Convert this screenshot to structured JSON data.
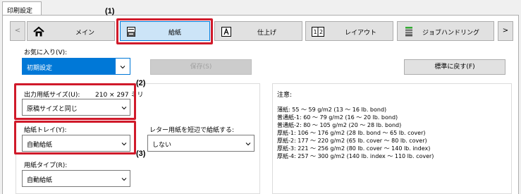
{
  "window": {
    "tab_label": "印刷設定"
  },
  "callouts": {
    "one": "(1)",
    "two": "(2)",
    "three": "(3)"
  },
  "nav": {
    "prev_arrow": "<",
    "next_arrow": ">",
    "tabs": [
      {
        "label": "メイン",
        "icon": "home-icon"
      },
      {
        "label": "給紙",
        "icon": "paper-tray-icon",
        "active": true
      },
      {
        "label": "仕上げ",
        "icon": "finishing-letter-a-icon"
      },
      {
        "label": "レイアウト",
        "icon": "layout-1-2-icon"
      },
      {
        "label": "ジョブハンドリング",
        "icon": "job-stack-icon"
      }
    ]
  },
  "favorites": {
    "label": "お気に入り(V):",
    "value": "初期設定",
    "save_button": "保存(S)",
    "reset_button": "標準に戻す(F)"
  },
  "output_size": {
    "label": "出力用紙サイズ(U):",
    "dimensions": "210 × 297 ミリ",
    "value": "原稿サイズと同じ"
  },
  "tray": {
    "label": "給紙トレイ(Y):",
    "value": "自動給紙"
  },
  "letter_rotate": {
    "label": "レター用紙を短辺で給紙する:",
    "value": "しない"
  },
  "paper_type": {
    "label": "用紙タイプ(R):",
    "value": "自動給紙"
  },
  "notes": {
    "title": "注意:",
    "lines": [
      "薄紙: 55 ～ 59 g/m2 (13 ～ 16 lb. bond)",
      "普通紙-1: 60 ～ 79 g/m2 (16 ～ 20 lb. bond)",
      "普通紙-2: 80 ～ 105 g/m2 (20 ～ 28 lb. bond)",
      "厚紙-1: 106 ～ 176 g/m2 (28 lb. bond ～ 65 lb. cover)",
      "厚紙-2: 177 ～ 220 g/m2 (65 lb. cover ～ 80 lb. cover)",
      "厚紙-3: 221 ～ 256 g/m2 (80 lb. cover ～ 140 lb. index)",
      "厚紙-4: 257 ～ 300 g/m2 (140 lb. index ～ 110 lb. cover)"
    ]
  },
  "colors": {
    "accent": "#0078d7",
    "highlight": "#d01a2a"
  }
}
